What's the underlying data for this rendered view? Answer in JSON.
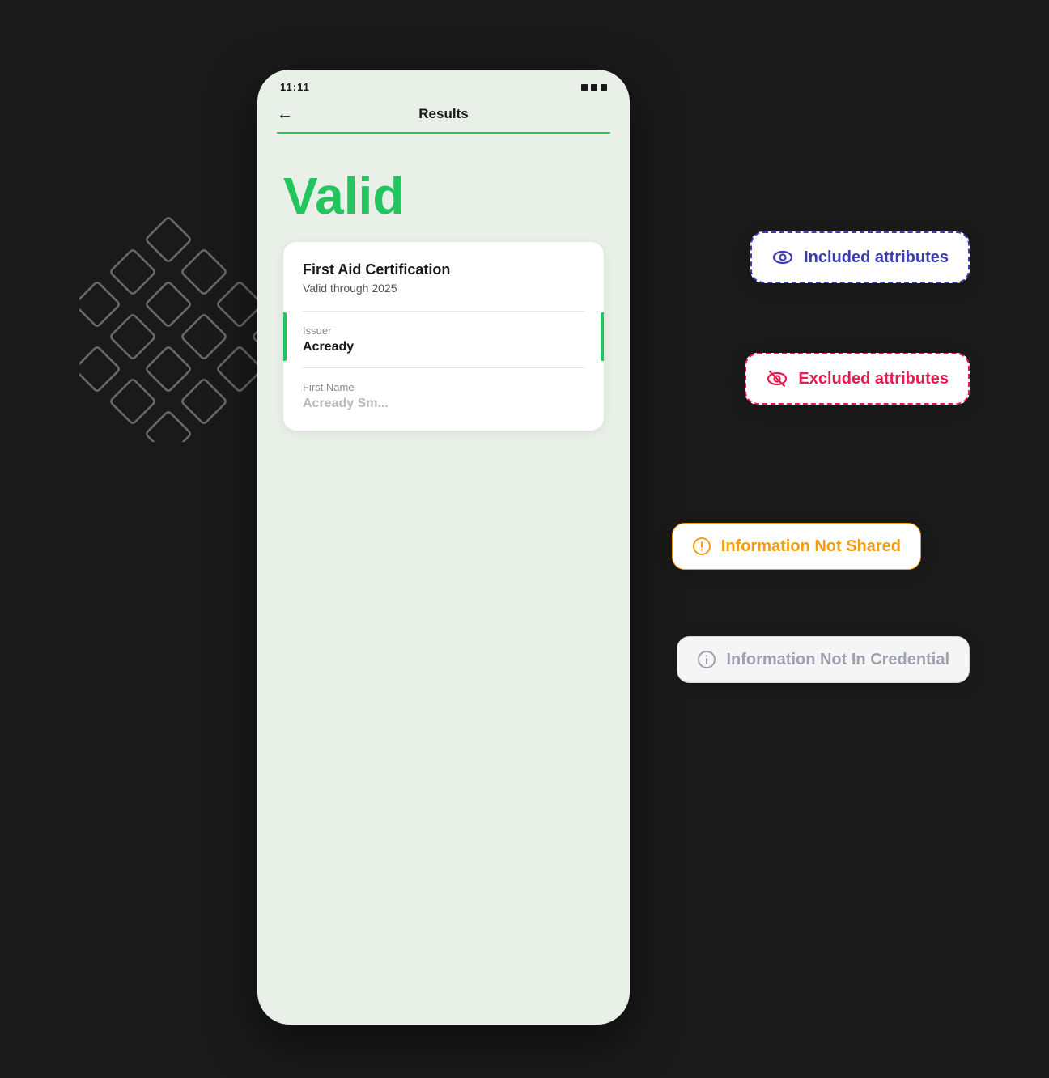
{
  "status_bar": {
    "time": "11:11",
    "icons_label": "status icons"
  },
  "nav": {
    "back_label": "←",
    "title": "Results"
  },
  "main": {
    "valid_label": "Valid"
  },
  "badges": {
    "included": {
      "label": "Included attributes"
    },
    "excluded": {
      "label": "Excluded attributes"
    },
    "not_shared": {
      "label": "Information Not Shared"
    },
    "not_in_credential": {
      "label": "Information Not In Credential"
    }
  },
  "credential": {
    "title": "First Aid Certification",
    "subtitle": "Valid through 2025",
    "issuer_label": "Issuer",
    "issuer_value": "Acready",
    "first_name_label": "First Name",
    "first_name_value": "Acready Sm..."
  }
}
